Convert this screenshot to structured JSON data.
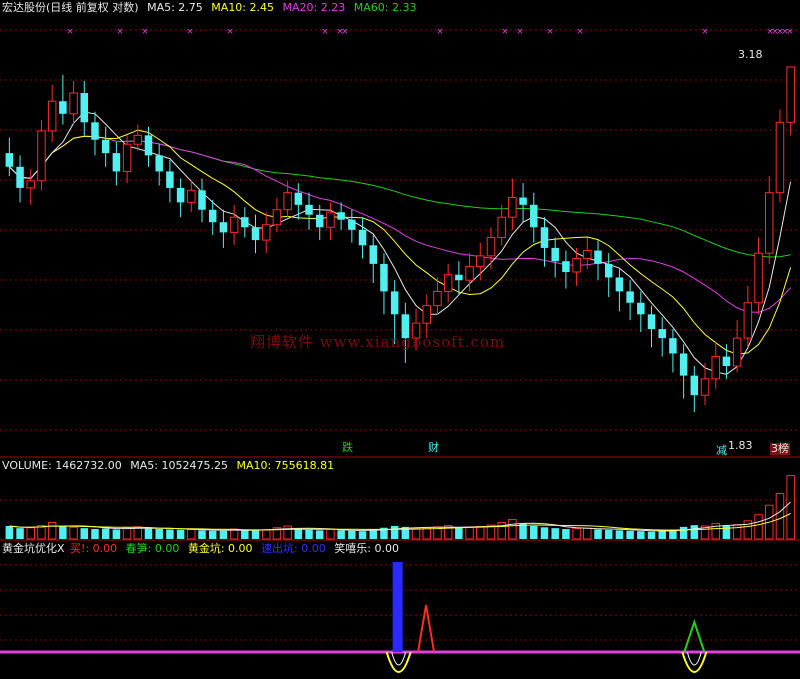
{
  "colors": {
    "white": "#e8e8e8",
    "yellow": "#ffff30",
    "magenta": "#e040e0",
    "green": "#20d020",
    "cyan": "#50f0f0",
    "red": "#ff2a2a",
    "blue": "#2a2aff",
    "grid": "#9a0000",
    "label": "#c0c0c0"
  },
  "header": {
    "stock": "宏达股份(日线 前复权 对数)",
    "ma5": "MA5: 2.75",
    "ma10": "MA10: 2.45",
    "ma20": "MA20: 2.23",
    "ma60": "MA60: 2.33"
  },
  "volume_header": {
    "volume": "VOLUME: 1462732.00",
    "ma5": "MA5: 1052475.25",
    "ma10": "MA10: 755618.81"
  },
  "indicator_header": {
    "name": "黄金坑优化X",
    "buy": "买!: 0.00",
    "chunsun": "春笋: 0.00",
    "huangjinkeng": "黄金坑: 0.00",
    "suchukou": "速出坑: 0.00",
    "xiluole": "笑嘻乐: 0.00"
  },
  "watermark": "翔博软件 www.xiangbosoft.com",
  "price_labels": {
    "high": "3.18",
    "low": "1.83"
  },
  "markers": {
    "die": "跌",
    "cai": "财",
    "jian": "减",
    "bang": "3榜"
  },
  "chart_data": {
    "type": "candlestick",
    "y_scale": "log",
    "ylim": [
      1.75,
      3.45
    ],
    "high_value": 3.18,
    "low_value": 1.83,
    "candles": [
      [
        2.77,
        2.71,
        2.84,
        2.67
      ],
      [
        2.71,
        2.62,
        2.76,
        2.56
      ],
      [
        2.62,
        2.65,
        2.7,
        2.55
      ],
      [
        2.65,
        2.87,
        2.92,
        2.61
      ],
      [
        2.87,
        3.01,
        3.09,
        2.82
      ],
      [
        3.01,
        2.95,
        3.14,
        2.9
      ],
      [
        2.95,
        3.05,
        3.11,
        2.9
      ],
      [
        3.05,
        2.91,
        3.11,
        2.85
      ],
      [
        2.91,
        2.83,
        2.96,
        2.76
      ],
      [
        2.83,
        2.77,
        2.89,
        2.71
      ],
      [
        2.77,
        2.69,
        2.82,
        2.63
      ],
      [
        2.69,
        2.81,
        2.85,
        2.64
      ],
      [
        2.81,
        2.85,
        2.9,
        2.78
      ],
      [
        2.85,
        2.76,
        2.89,
        2.71
      ],
      [
        2.76,
        2.69,
        2.81,
        2.63
      ],
      [
        2.69,
        2.62,
        2.74,
        2.56
      ],
      [
        2.62,
        2.56,
        2.66,
        2.5
      ],
      [
        2.56,
        2.61,
        2.65,
        2.52
      ],
      [
        2.61,
        2.53,
        2.66,
        2.48
      ],
      [
        2.53,
        2.48,
        2.57,
        2.43
      ],
      [
        2.48,
        2.44,
        2.53,
        2.38
      ],
      [
        2.44,
        2.5,
        2.55,
        2.39
      ],
      [
        2.5,
        2.46,
        2.54,
        2.42
      ],
      [
        2.46,
        2.41,
        2.51,
        2.36
      ],
      [
        2.41,
        2.47,
        2.52,
        2.36
      ],
      [
        2.47,
        2.53,
        2.58,
        2.44
      ],
      [
        2.53,
        2.6,
        2.65,
        2.5
      ],
      [
        2.6,
        2.55,
        2.64,
        2.49
      ],
      [
        2.55,
        2.51,
        2.6,
        2.45
      ],
      [
        2.51,
        2.46,
        2.55,
        2.41
      ],
      [
        2.46,
        2.52,
        2.56,
        2.41
      ],
      [
        2.52,
        2.49,
        2.56,
        2.45
      ],
      [
        2.49,
        2.45,
        2.53,
        2.4
      ],
      [
        2.45,
        2.39,
        2.5,
        2.34
      ],
      [
        2.39,
        2.32,
        2.43,
        2.25
      ],
      [
        2.32,
        2.22,
        2.36,
        2.14
      ],
      [
        2.22,
        2.14,
        2.26,
        2.04
      ],
      [
        2.14,
        2.06,
        2.18,
        1.98
      ],
      [
        2.06,
        2.11,
        2.16,
        2.02
      ],
      [
        2.11,
        2.17,
        2.21,
        2.06
      ],
      [
        2.17,
        2.22,
        2.27,
        2.14
      ],
      [
        2.22,
        2.28,
        2.32,
        2.18
      ],
      [
        2.28,
        2.26,
        2.33,
        2.21
      ],
      [
        2.26,
        2.31,
        2.36,
        2.22
      ],
      [
        2.31,
        2.35,
        2.4,
        2.26
      ],
      [
        2.35,
        2.42,
        2.46,
        2.3
      ],
      [
        2.42,
        2.5,
        2.55,
        2.39
      ],
      [
        2.5,
        2.58,
        2.66,
        2.45
      ],
      [
        2.58,
        2.55,
        2.64,
        2.48
      ],
      [
        2.55,
        2.46,
        2.6,
        2.4
      ],
      [
        2.46,
        2.38,
        2.5,
        2.31
      ],
      [
        2.38,
        2.33,
        2.42,
        2.27
      ],
      [
        2.33,
        2.29,
        2.37,
        2.23
      ],
      [
        2.29,
        2.34,
        2.38,
        2.24
      ],
      [
        2.34,
        2.37,
        2.42,
        2.3
      ],
      [
        2.37,
        2.32,
        2.41,
        2.26
      ],
      [
        2.32,
        2.27,
        2.36,
        2.2
      ],
      [
        2.27,
        2.22,
        2.3,
        2.15
      ],
      [
        2.22,
        2.18,
        2.26,
        2.12
      ],
      [
        2.18,
        2.14,
        2.22,
        2.08
      ],
      [
        2.14,
        2.09,
        2.17,
        2.03
      ],
      [
        2.09,
        2.06,
        2.13,
        2.0
      ],
      [
        2.06,
        2.01,
        2.09,
        1.95
      ],
      [
        2.01,
        1.94,
        2.04,
        1.87
      ],
      [
        1.94,
        1.88,
        1.97,
        1.83
      ],
      [
        1.88,
        1.93,
        1.98,
        1.85
      ],
      [
        1.93,
        2.0,
        2.05,
        1.9
      ],
      [
        2.0,
        1.97,
        2.04,
        1.93
      ],
      [
        1.97,
        2.06,
        2.12,
        1.95
      ],
      [
        2.06,
        2.18,
        2.24,
        2.03
      ],
      [
        2.18,
        2.36,
        2.42,
        2.14
      ],
      [
        2.36,
        2.6,
        2.67,
        2.32
      ],
      [
        2.6,
        2.91,
        2.97,
        2.56
      ],
      [
        2.91,
        3.18,
        3.18,
        2.85
      ]
    ],
    "volume": {
      "ylim": [
        0,
        1500000
      ],
      "values": [
        300000,
        250000,
        260000,
        310000,
        380000,
        290000,
        270000,
        250000,
        230000,
        240000,
        220000,
        260000,
        280000,
        240000,
        230000,
        220000,
        210000,
        220000,
        200000,
        190000,
        190000,
        230000,
        210000,
        200000,
        220000,
        260000,
        300000,
        240000,
        210000,
        200000,
        220000,
        200000,
        190000,
        180000,
        220000,
        260000,
        300000,
        280000,
        240000,
        260000,
        280000,
        310000,
        260000,
        270000,
        290000,
        320000,
        380000,
        450000,
        360000,
        300000,
        270000,
        250000,
        230000,
        240000,
        250000,
        220000,
        210000,
        200000,
        190000,
        180000,
        170000,
        180000,
        220000,
        280000,
        320000,
        300000,
        360000,
        300000,
        330000,
        420000,
        560000,
        780000,
        1050000,
        1462732
      ]
    },
    "indicator": {
      "buy": [
        0,
        0,
        0,
        0,
        0,
        0,
        0,
        0,
        0,
        0,
        0,
        0,
        0,
        0,
        0,
        0,
        0,
        0,
        0,
        0,
        0,
        0,
        0,
        0,
        0,
        0,
        0,
        0,
        0,
        0,
        0,
        0,
        0,
        0,
        0,
        0,
        1,
        0,
        0,
        0,
        0,
        0,
        0,
        0,
        0,
        0,
        0,
        0,
        0,
        0,
        0,
        0,
        0,
        0,
        0,
        0,
        0,
        0,
        0,
        0,
        0,
        0,
        0,
        0,
        0,
        0,
        0,
        0,
        0,
        0,
        0,
        0,
        0,
        0
      ],
      "chunsun": [
        0,
        0,
        0,
        0,
        0,
        0,
        0,
        0,
        0,
        0,
        0,
        0,
        0,
        0,
        0,
        0,
        0,
        0,
        0,
        0,
        0,
        0,
        0,
        0,
        0,
        0,
        0,
        0,
        0,
        0,
        0,
        0,
        0,
        0,
        0,
        0,
        0,
        0,
        0,
        0,
        0,
        0,
        0,
        0,
        0,
        0,
        0,
        0,
        0,
        0,
        0,
        0,
        0,
        0,
        0,
        0,
        0,
        0,
        0,
        0,
        0,
        0,
        0,
        0,
        1,
        0,
        0,
        0,
        0,
        0,
        0,
        0,
        0,
        0
      ],
      "suchukou": [
        0,
        0,
        0,
        0,
        0,
        0,
        0,
        0,
        0,
        0,
        0,
        0,
        0,
        0,
        0,
        0,
        0,
        0,
        0,
        0,
        0,
        0,
        0,
        0,
        0,
        0,
        0,
        0,
        0,
        0,
        0,
        0,
        0,
        0,
        0,
        0,
        1,
        0,
        0,
        0,
        0,
        0,
        0,
        0,
        0,
        0,
        0,
        0,
        0,
        0,
        0,
        0,
        0,
        0,
        0,
        0,
        0,
        0,
        0,
        0,
        0,
        0,
        0,
        0,
        0,
        0,
        0,
        0,
        0,
        0,
        0,
        0,
        0,
        0
      ],
      "huangjinkeng": [
        0,
        0,
        0,
        0,
        0,
        0,
        0,
        0,
        0,
        0,
        0,
        0,
        0,
        0,
        0,
        0,
        0,
        0,
        0,
        0,
        0,
        0,
        0,
        0,
        0,
        0,
        0,
        0,
        0,
        0,
        0,
        0,
        0,
        0,
        0,
        0,
        1,
        0,
        0,
        0,
        0,
        0,
        0,
        0,
        0,
        0,
        0,
        0,
        0,
        0,
        0,
        0,
        0,
        0,
        0,
        0,
        0,
        0,
        0,
        0,
        0,
        0,
        0,
        0,
        1,
        0,
        0,
        0,
        0,
        0,
        0,
        0,
        0,
        0
      ],
      "xiluole": [
        0,
        0,
        0,
        0,
        0,
        0,
        0,
        0,
        0,
        0,
        0,
        0,
        0,
        0,
        0,
        0,
        0,
        0,
        0,
        0,
        0,
        0,
        0,
        0,
        0,
        0,
        0,
        0,
        0,
        0,
        0,
        0,
        0,
        0,
        0,
        0,
        0,
        0,
        1,
        0,
        0,
        0,
        0,
        0,
        0,
        0,
        0,
        0,
        0,
        0,
        0,
        0,
        0,
        0,
        0,
        0,
        0,
        0,
        0,
        0,
        0,
        0,
        0,
        0,
        0,
        0,
        0,
        0,
        0,
        0,
        0,
        0,
        0,
        0
      ]
    }
  }
}
